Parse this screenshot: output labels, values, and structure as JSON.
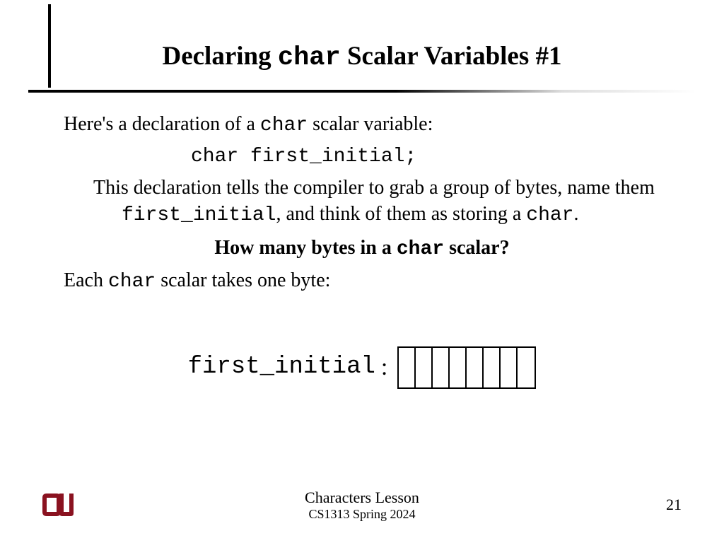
{
  "title": {
    "part1": "Declaring ",
    "code": "char",
    "part2": " Scalar Variables #1"
  },
  "body": {
    "intro_part1": "Here's a declaration of a ",
    "intro_code": "char",
    "intro_part2": " scalar variable:",
    "decl_code": "char first_initial;",
    "explain_part1": "This declaration tells the compiler to grab a group of bytes, name them ",
    "explain_code1": "first_initial",
    "explain_part2": ", and think of them as storing a ",
    "explain_code2": "char",
    "explain_part3": ".",
    "question_part1": "How many bytes in a ",
    "question_code": "char",
    "question_part2": " scalar?",
    "answer_part1": "Each ",
    "answer_code": "char",
    "answer_part2": " scalar takes one byte:",
    "byte_label": "first_initial",
    "byte_colon": ":",
    "byte_cells": 8
  },
  "footer": {
    "lesson": "Characters Lesson",
    "course": "CS1313 Spring 2024",
    "page": "21"
  }
}
